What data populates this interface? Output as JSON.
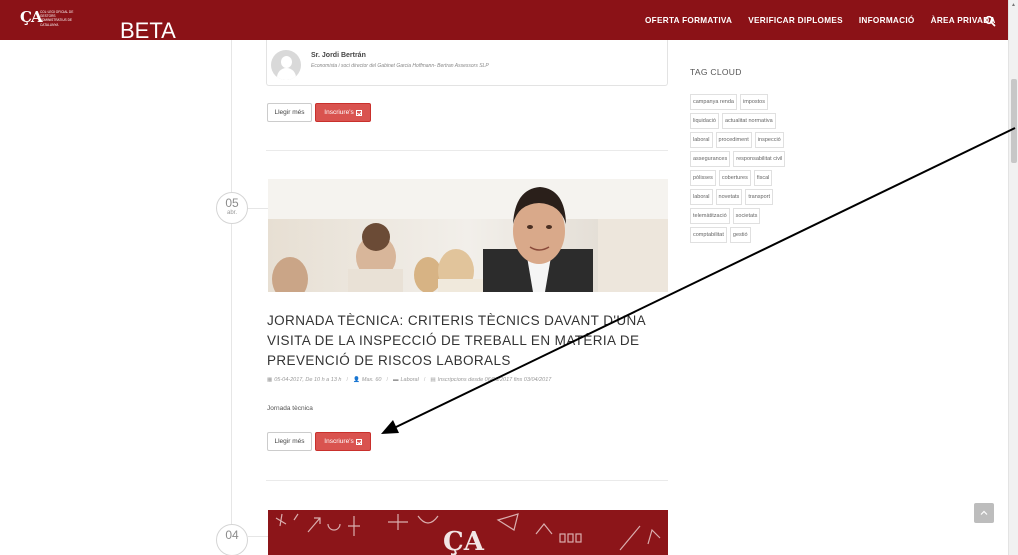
{
  "header": {
    "logo_mark": "ÇA",
    "logo_text": "COL·LEGI OFICIAL DE GESTORS ADMINISTRATIUS DE CATALUNYA",
    "beta_label": "BETA",
    "nav": [
      {
        "label": "OFERTA FORMATIVA"
      },
      {
        "label": "VERIFICAR DIPLOMES"
      },
      {
        "label": "INFORMACIÓ"
      },
      {
        "label": "ÀREA PRIVADA"
      }
    ],
    "search_icon": "search-icon"
  },
  "speaker": {
    "name": "Sr. Jordi Bertrán",
    "role": "Economista i soci director del Gabinet Garcia Hoffmann- Bertran Assessors SLP"
  },
  "event_prev": {
    "more_label": "Llegir més",
    "signup_label": "Inscriure's"
  },
  "event": {
    "date_day": "05",
    "date_month": "abr.",
    "title": "JORNADA TÈCNICA: CRITERIS TÈCNICS DAVANT D'UNA VISITA DE LA INSPECCIÓ DE TREBALL EN MATÈRIA DE PREVENCIÓ DE RISCOS LABORALS",
    "meta_date": "05-04-2017, De 10 h a 13 h",
    "meta_capacity": "Max. 60",
    "meta_category": "Laboral",
    "meta_enrollment": "Inscripcions desde 06/03/2017 fins 03/04/2017",
    "summary": "Jornada tècnica",
    "more_label": "Llegir més",
    "signup_label": "Inscriure's"
  },
  "next_event": {
    "date_day": "04"
  },
  "sidebar": {
    "tag_title": "TAG CLOUD",
    "tag_rows": [
      [
        "campanya renda",
        "impostos"
      ],
      [
        "liquidació",
        "actualitat normativa"
      ],
      [
        "laboral",
        "procediment",
        "inspecció"
      ],
      [
        "assegurances",
        "responsabilitat civil"
      ],
      [
        "pòlisses",
        "cobertures",
        "fiscal"
      ],
      [
        "laboral",
        "novetats",
        "transport"
      ],
      [
        "telemàtització",
        "societats"
      ],
      [
        "comptabilitat",
        "gestió"
      ]
    ]
  },
  "colors": {
    "brand": "#8b1217",
    "signup": "#d9534f"
  }
}
